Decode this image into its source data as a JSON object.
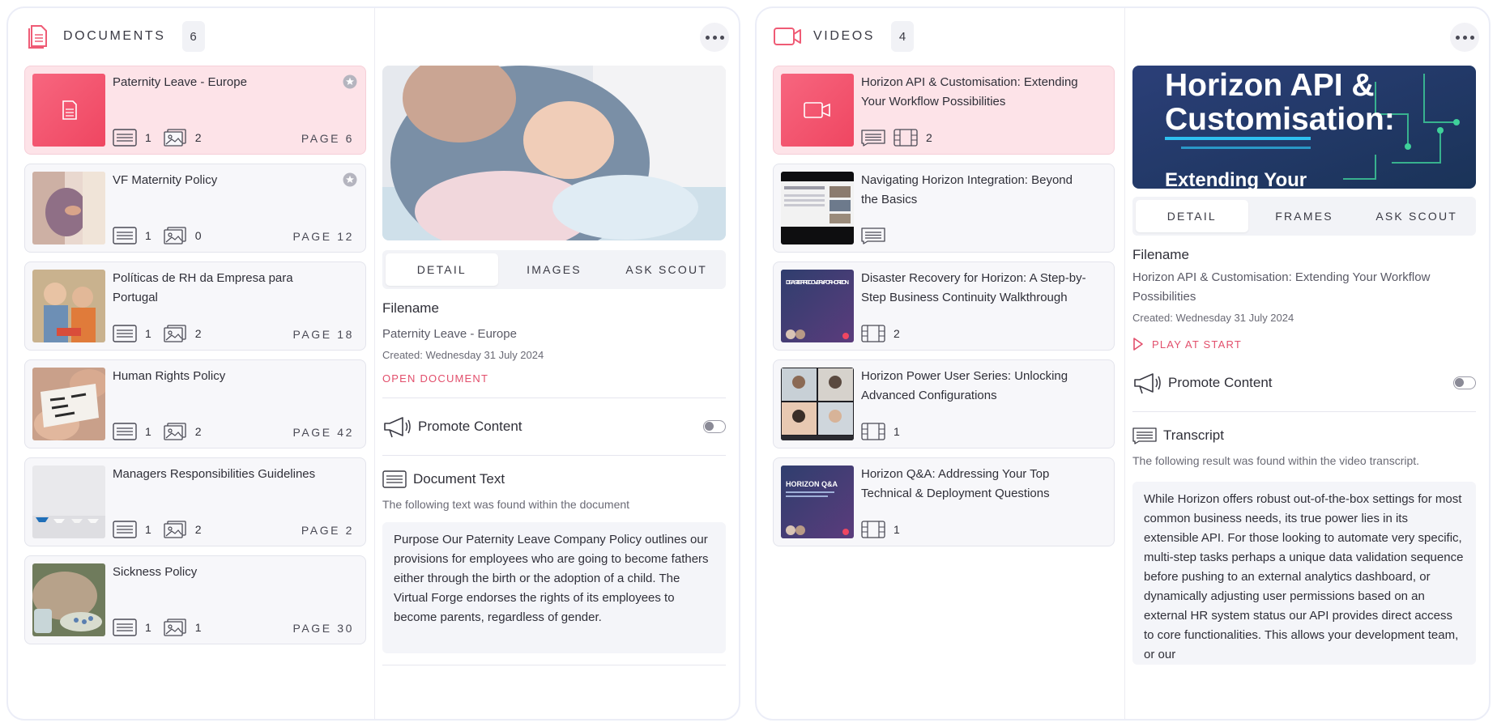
{
  "documents": {
    "title": "DOCUMENTS",
    "count": "6",
    "items": [
      {
        "title": "Paternity Leave - Europe",
        "texts": "1",
        "images": "2",
        "page": "PAGE 6"
      },
      {
        "title": "VF Maternity Policy",
        "texts": "1",
        "images": "0",
        "page": "PAGE 12"
      },
      {
        "title": "Políticas de RH da Empresa para Portugal",
        "texts": "1",
        "images": "2",
        "page": "PAGE 18"
      },
      {
        "title": "Human Rights Policy",
        "texts": "1",
        "images": "2",
        "page": "PAGE 42"
      },
      {
        "title": "Managers Responsibilities Guidelines",
        "texts": "1",
        "images": "2",
        "page": "PAGE 2"
      },
      {
        "title": "Sickness Policy",
        "texts": "1",
        "images": "1",
        "page": "PAGE 30"
      }
    ],
    "detail": {
      "tabs": [
        "DETAIL",
        "IMAGES",
        "ASK SCOUT"
      ],
      "filename_label": "Filename",
      "filename": "Paternity Leave - Europe",
      "created": "Created: Wednesday 31 July 2024",
      "action": "OPEN DOCUMENT",
      "promote_label": "Promote Content",
      "section_title": "Document Text",
      "section_sub": "The following text was found within the document",
      "text": "Purpose Our Paternity Leave Company Policy outlines our provisions for employees who are going to become fathers either through the birth or the adoption of a child. The Virtual Forge endorses the rights of its employees to become parents, regardless of gender."
    }
  },
  "videos": {
    "title": "VIDEOS",
    "count": "4",
    "items": [
      {
        "title": "Horizon API & Customisation: Extending Your Workflow Possibilities",
        "frames": "2"
      },
      {
        "title": "Navigating Horizon Integration: Beyond the Basics",
        "frames": ""
      },
      {
        "title": "Disaster Recovery for Horizon: A Step-by-Step Business Continuity Walkthrough",
        "frames": "2",
        "thumb_text": "DISASTER RECOVERY FOR HORIZON"
      },
      {
        "title": "Horizon Power User Series: Unlocking Advanced Configurations",
        "frames": "1"
      },
      {
        "title": "Horizon Q&A: Addressing Your Top Technical & Deployment Questions",
        "frames": "1",
        "thumb_text": "HORIZON Q&A"
      }
    ],
    "detail": {
      "hero_line1": "Horizon API &",
      "hero_line2": "Customisation:",
      "hero_line3": "Extending Your",
      "tabs": [
        "DETAIL",
        "FRAMES",
        "ASK SCOUT"
      ],
      "filename_label": "Filename",
      "filename": "Horizon API & Customisation: Extending Your Workflow Possibilities",
      "created": "Created: Wednesday 31 July 2024",
      "action": "PLAY AT START",
      "promote_label": "Promote Content",
      "section_title": "Transcript",
      "section_sub": "The following result was found within the video transcript.",
      "text": "While Horizon offers robust out-of-the-box settings for most common business needs, its true power lies in its extensible API. For those looking to automate very specific, multi-step tasks perhaps a unique data validation sequence before pushing to an external analytics dashboard, or dynamically adjusting user permissions based on an external HR system status our API provides direct access to core functionalities. This allows your development team, or our"
    }
  },
  "colors": {
    "accent": "#e24f6c",
    "active_card": "#fde3e8",
    "card": "#f7f7fa"
  }
}
